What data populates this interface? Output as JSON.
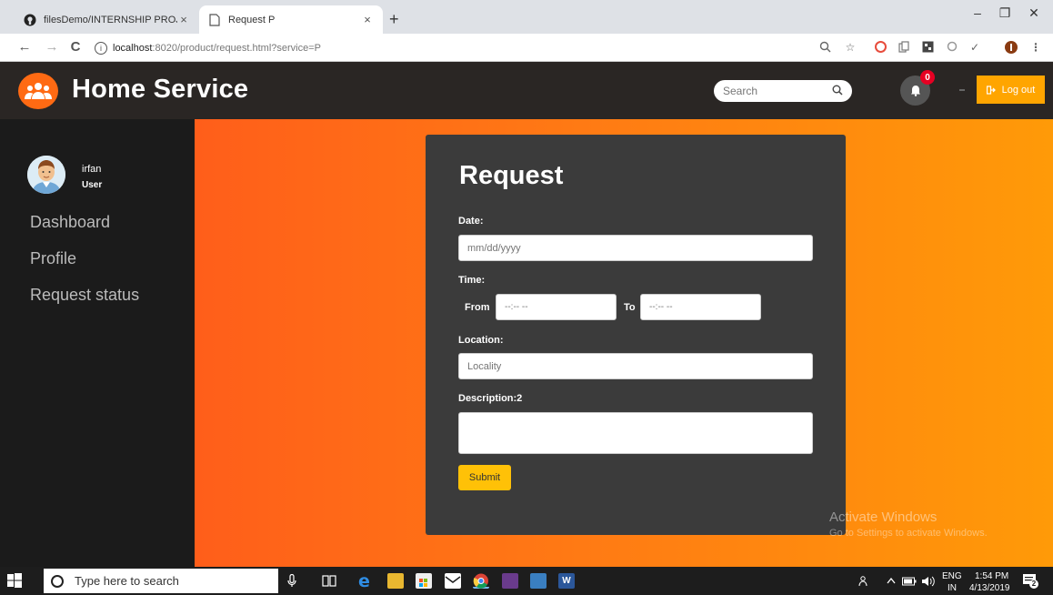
{
  "browser": {
    "tabs": [
      {
        "title": "filesDemo/INTERNSHIP PROJECT",
        "close": "×"
      },
      {
        "title": "Request P",
        "close": "×"
      }
    ],
    "new_tab": "+",
    "window": {
      "minimize": "–",
      "restore": "❐",
      "close": "✕"
    },
    "url_host": "localhost",
    "url_path": ":8020/product/request.html?service=P",
    "nav": {
      "back": "←",
      "forward": "→",
      "reload": "C"
    }
  },
  "header": {
    "brand": "Home Service",
    "search_placeholder": "Search",
    "notification_count": "0",
    "logout_label": "Log out",
    "colors": {
      "accent": "#ff6a13",
      "logout": "#ffa500"
    }
  },
  "sidebar": {
    "user_name": "irfan",
    "user_role": "User",
    "items": [
      {
        "label": "Dashboard"
      },
      {
        "label": "Profile"
      },
      {
        "label": "Request status"
      }
    ]
  },
  "form": {
    "title": "Request",
    "date_label": "Date:",
    "date_placeholder": "mm/dd/yyyy",
    "time_label": "Time:",
    "from_label": "From",
    "to_label": "To",
    "time_placeholder": "--:-- --",
    "location_label": "Location:",
    "location_placeholder": "Locality",
    "description_label": "Description:2",
    "submit_label": "Submit"
  },
  "watermark": {
    "line1": "Activate Windows",
    "line2": "Go to Settings to activate Windows."
  },
  "taskbar": {
    "search_placeholder": "Type here to search",
    "language": "ENG",
    "region": "IN",
    "time": "1:54 PM",
    "date": "4/13/2019",
    "notifications": "2"
  }
}
